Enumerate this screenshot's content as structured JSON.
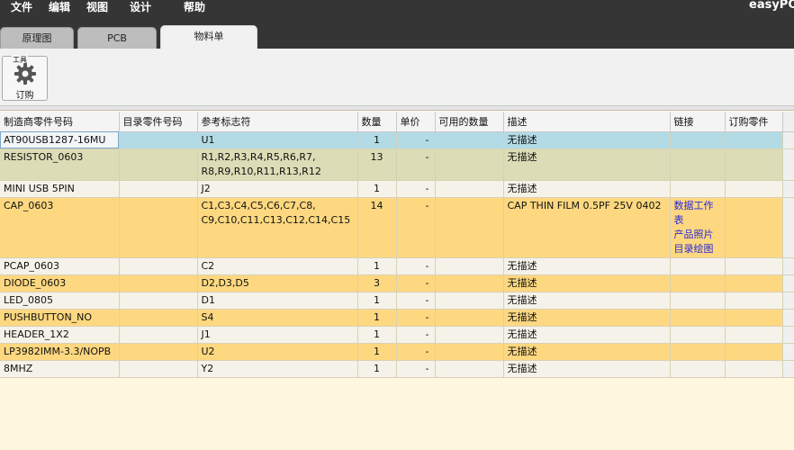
{
  "menu": [
    "文件",
    "编辑",
    "视图",
    "设计",
    "帮助"
  ],
  "brand": "easyPC",
  "tabs": [
    "原理图",
    "PCB",
    "物料单"
  ],
  "active_tab": 2,
  "toolbar": {
    "group_label": "工具",
    "order_label": "订购",
    "order_icon": "gear-icon"
  },
  "table": {
    "columns": [
      "制造商零件号码",
      "目录零件号码",
      "参考标志符",
      "数量",
      "单价",
      "可用的数量",
      "描述",
      "链接",
      "订购零件"
    ],
    "rows": [
      {
        "style": "blue",
        "mfr": "AT90USB1287-16MU",
        "cat": "",
        "ref": [
          "U1"
        ],
        "qty": "1",
        "price": "-",
        "avail": "",
        "desc": "无描述",
        "links": [],
        "order": ""
      },
      {
        "style": "olive",
        "mfr": "RESISTOR_0603",
        "cat": "",
        "ref": [
          "R1,R2,R3,R4,R5,R6,R7,",
          "R8,R9,R10,R11,R13,R12"
        ],
        "qty": "13",
        "price": "-",
        "avail": "",
        "desc": "无描述",
        "links": [],
        "order": ""
      },
      {
        "style": "white",
        "mfr": "MINI USB 5PIN",
        "cat": "",
        "ref": [
          "J2"
        ],
        "qty": "1",
        "price": "-",
        "avail": "",
        "desc": "无描述",
        "links": [],
        "order": ""
      },
      {
        "style": "orange",
        "mfr": "CAP_0603",
        "cat": "",
        "ref": [
          "C1,C3,C4,C5,C6,C7,C8,",
          "C9,C10,C11,C13,C12,C14,C15"
        ],
        "qty": "14",
        "price": "-",
        "avail": "",
        "desc": "CAP THIN FILM 0.5PF 25V 0402",
        "links": [
          "数据工作表",
          "产品照片",
          "目录绘图"
        ],
        "order": ""
      },
      {
        "style": "white",
        "mfr": "PCAP_0603",
        "cat": "",
        "ref": [
          "C2"
        ],
        "qty": "1",
        "price": "-",
        "avail": "",
        "desc": "无描述",
        "links": [],
        "order": ""
      },
      {
        "style": "orange",
        "mfr": "DIODE_0603",
        "cat": "",
        "ref": [
          "D2,D3,D5"
        ],
        "qty": "3",
        "price": "-",
        "avail": "",
        "desc": "无描述",
        "links": [],
        "order": ""
      },
      {
        "style": "white",
        "mfr": "LED_0805",
        "cat": "",
        "ref": [
          "D1"
        ],
        "qty": "1",
        "price": "-",
        "avail": "",
        "desc": "无描述",
        "links": [],
        "order": ""
      },
      {
        "style": "orange",
        "mfr": "PUSHBUTTON_NO",
        "cat": "",
        "ref": [
          "S4"
        ],
        "qty": "1",
        "price": "-",
        "avail": "",
        "desc": "无描述",
        "links": [],
        "order": ""
      },
      {
        "style": "white",
        "mfr": "HEADER_1X2",
        "cat": "",
        "ref": [
          "J1"
        ],
        "qty": "1",
        "price": "-",
        "avail": "",
        "desc": "无描述",
        "links": [],
        "order": ""
      },
      {
        "style": "orange",
        "mfr": "LP3982IMM-3.3/NOPB",
        "cat": "",
        "ref": [
          "U2"
        ],
        "qty": "1",
        "price": "-",
        "avail": "",
        "desc": "无描述",
        "links": [],
        "order": ""
      },
      {
        "style": "white",
        "mfr": "8MHZ",
        "cat": "",
        "ref": [
          "Y2"
        ],
        "qty": "1",
        "price": "-",
        "avail": "",
        "desc": "无描述",
        "links": [],
        "order": ""
      }
    ]
  }
}
